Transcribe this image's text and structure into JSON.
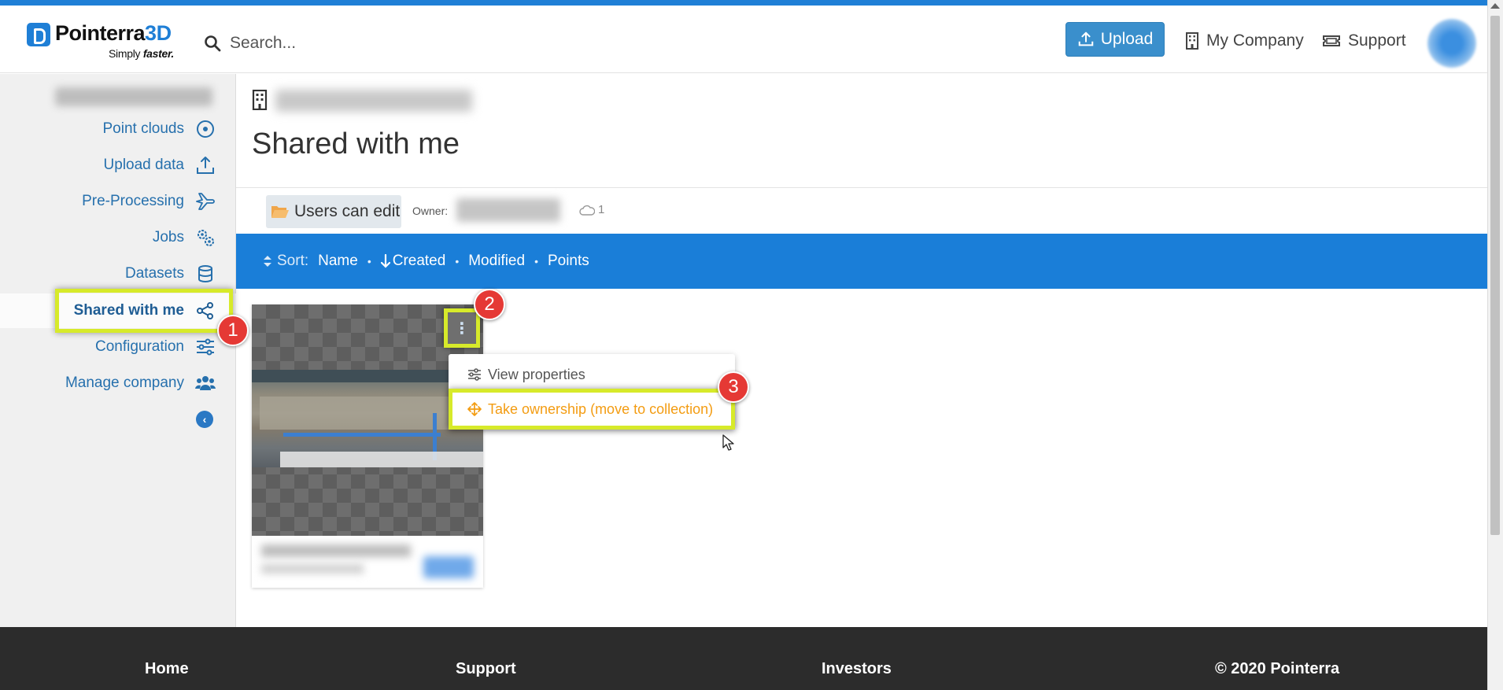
{
  "header": {
    "logo_name": "Pointerra",
    "logo_accent": "3D",
    "logo_tagline_plain": "Simply",
    "logo_tagline_bold": "faster.",
    "search_placeholder": "Search...",
    "upload_label": "Upload",
    "company_label": "My Company",
    "support_label": "Support"
  },
  "sidebar": {
    "items": [
      {
        "label": "Point clouds",
        "icon": "target-icon"
      },
      {
        "label": "Upload data",
        "icon": "upload-icon"
      },
      {
        "label": "Pre-Processing",
        "icon": "plane-icon"
      },
      {
        "label": "Jobs",
        "icon": "gears-icon"
      },
      {
        "label": "Datasets",
        "icon": "database-icon"
      },
      {
        "label": "Shared with me",
        "icon": "share-icon",
        "active": true
      },
      {
        "label": "Configuration",
        "icon": "sliders-icon"
      },
      {
        "label": "Manage company",
        "icon": "users-icon"
      }
    ],
    "collapse_glyph": "‹"
  },
  "main": {
    "page_title": "Shared with me",
    "folder_label": "Users can edit",
    "owner_label": "Owner:",
    "cloud_count": "1",
    "sort": {
      "label": "Sort:",
      "options": [
        "Name",
        "Created",
        "Modified",
        "Points"
      ],
      "active": "Created"
    }
  },
  "context_menu": {
    "kebab_glyph": "⋮",
    "view_properties": "View properties",
    "take_ownership": "Take ownership (move to collection)"
  },
  "annotations": {
    "step1": "1",
    "step2": "2",
    "step3": "3"
  },
  "footer": {
    "home": "Home",
    "support": "Support",
    "investors": "Investors",
    "copyright": "© 2020 Pointerra"
  },
  "colors": {
    "brand_blue": "#1f7fd6",
    "highlight": "#d7ea2a",
    "badge_red": "#e53935",
    "menu_orange": "#f39c12"
  }
}
